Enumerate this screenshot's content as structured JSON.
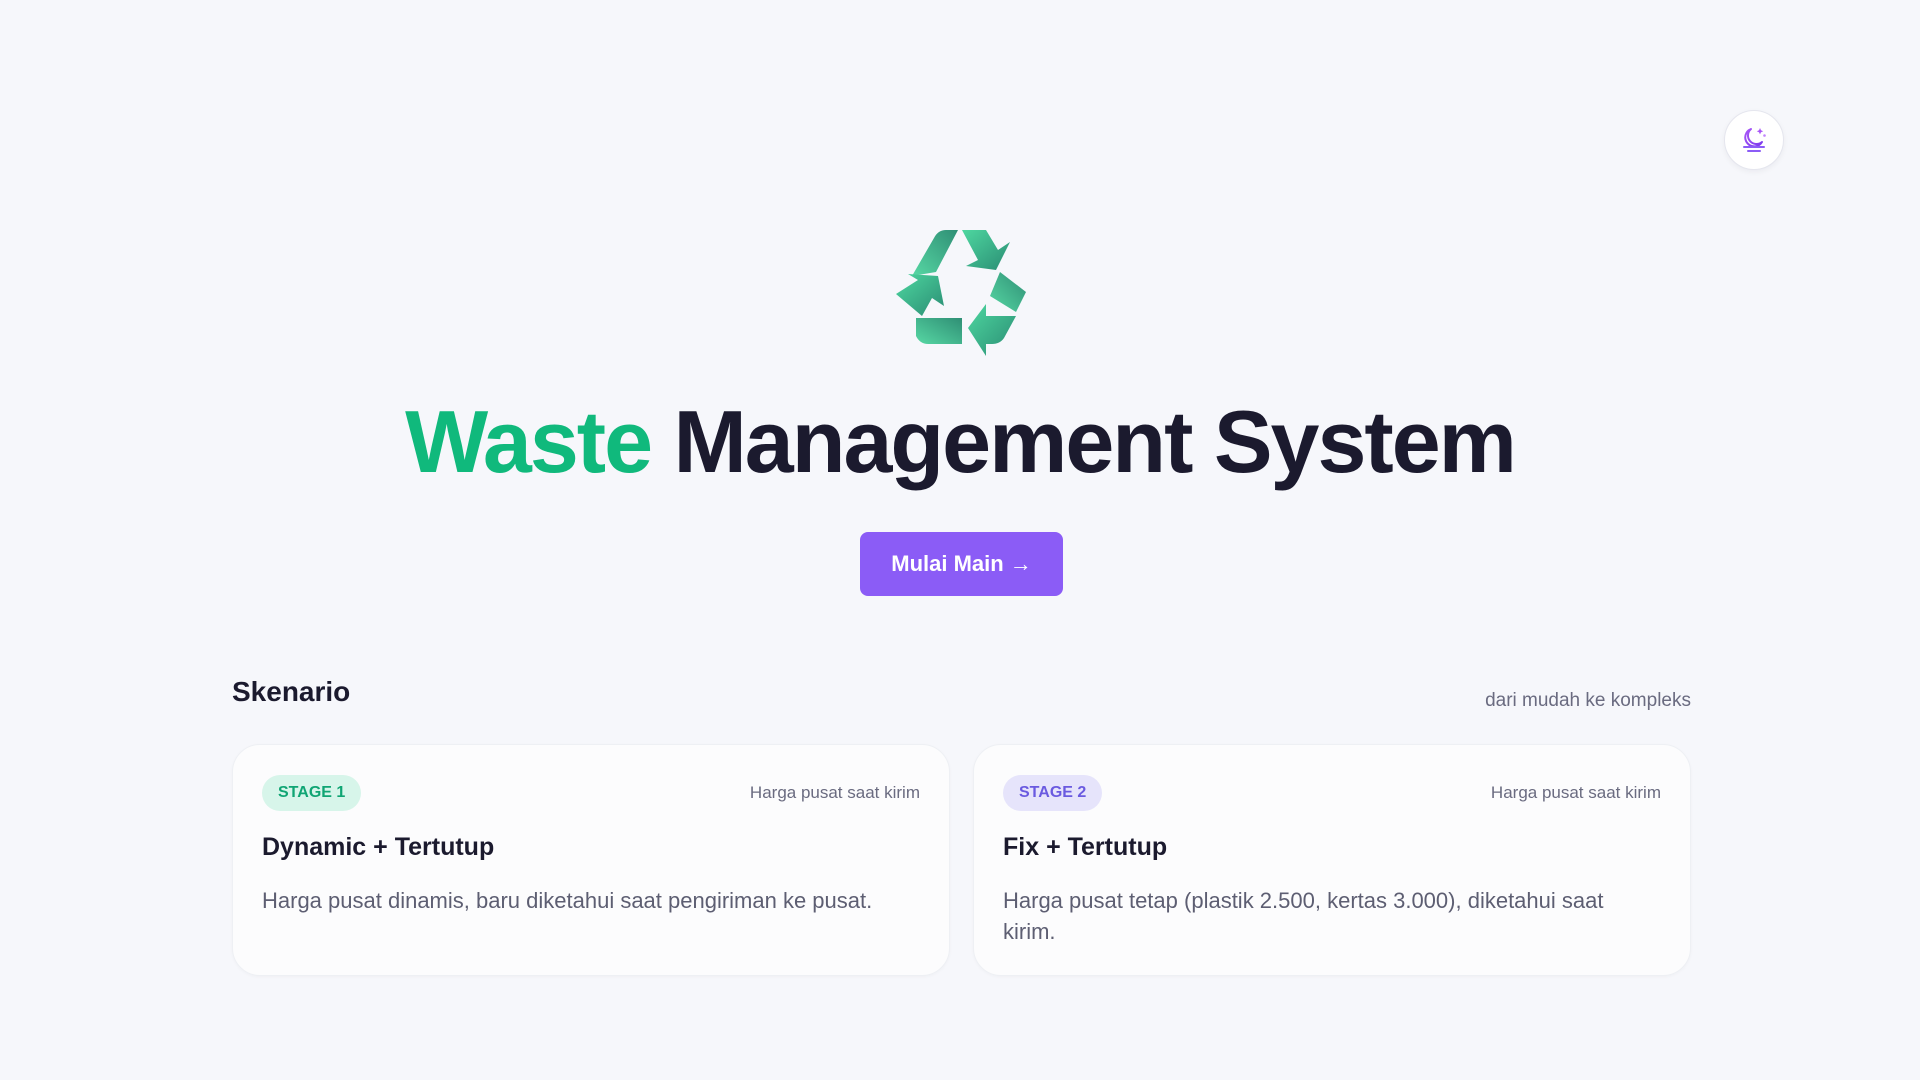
{
  "header": {
    "theme_toggle_icon": "moon-stars-icon"
  },
  "hero": {
    "logo_icon": "recycle-icon",
    "title_accent": "Waste",
    "title_rest": "Management System",
    "accent_color": "#10b97c",
    "start_button_label": "Mulai Main",
    "start_button_arrow": "→",
    "button_color": "#8b5cf6"
  },
  "scenarios": {
    "title": "Skenario",
    "hint": "dari mudah ke kompleks",
    "cards": [
      {
        "badge": "STAGE 1",
        "meta": "Harga pusat saat kirim",
        "title": "Dynamic + Tertutup",
        "description": "Harga pusat dinamis, baru diketahui saat pengiriman ke pusat."
      },
      {
        "badge": "STAGE 2",
        "meta": "Harga pusat saat kirim",
        "title": "Fix + Tertutup",
        "description": "Harga pusat tetap (plastik 2.500, kertas 3.000), diketahui saat kirim."
      }
    ]
  }
}
